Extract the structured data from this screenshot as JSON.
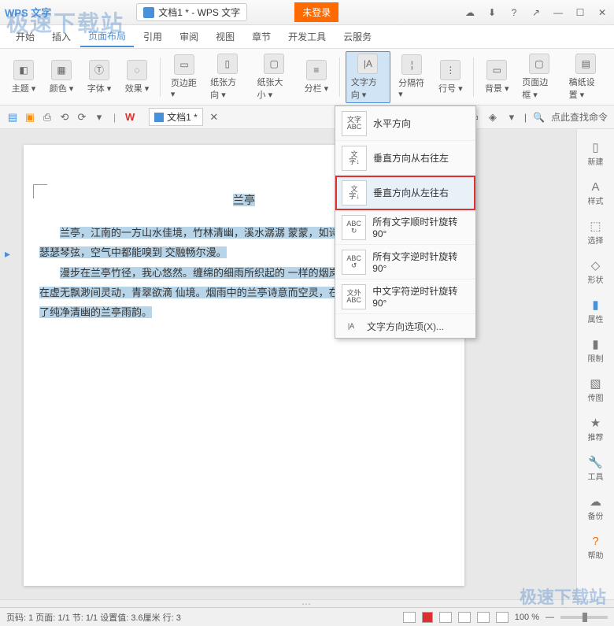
{
  "watermark": {
    "top": "极速下载站",
    "bottom": "极速下载站"
  },
  "titlebar": {
    "app": "WPS 文字",
    "doc": "文档1 * - WPS 文字",
    "login": "未登录",
    "icons": [
      "☁",
      "⬇",
      "?",
      "↗",
      "—",
      "☐",
      "✕"
    ]
  },
  "menu": {
    "items": [
      "开始",
      "插入",
      "页面布局",
      "引用",
      "审阅",
      "视图",
      "章节",
      "开发工具",
      "云服务"
    ],
    "active_index": 2
  },
  "ribbon": {
    "groups": [
      {
        "label": "主题",
        "icon": "◧"
      },
      {
        "label": "颜色",
        "icon": "▦"
      },
      {
        "label": "字体",
        "icon": "Ⓣ"
      },
      {
        "label": "效果",
        "icon": "◌"
      },
      {
        "label": "页边距",
        "icon": "▭"
      },
      {
        "label": "纸张方向",
        "icon": "▯"
      },
      {
        "label": "纸张大小",
        "icon": "▢"
      },
      {
        "label": "分栏",
        "icon": "≡"
      },
      {
        "label": "文字方向",
        "icon": "|A",
        "active": true
      },
      {
        "label": "分隔符",
        "icon": "¦"
      },
      {
        "label": "行号",
        "icon": "⋮"
      },
      {
        "label": "背景",
        "icon": "▭"
      },
      {
        "label": "页面边框",
        "icon": "▢"
      },
      {
        "label": "稿纸设置",
        "icon": "▤"
      }
    ]
  },
  "quick": {
    "left_icons": [
      "▤",
      "▣",
      "⎙",
      "⟲",
      "⟳",
      "▾"
    ],
    "w_icon": "W",
    "doc_tab": "文档1 *",
    "close": "✕",
    "right_icons": [
      "▭",
      "◈",
      "▾"
    ],
    "search_label": "点此查找命令"
  },
  "dropdown": {
    "items": [
      {
        "icon_top": "文字",
        "icon_bottom": "ABC",
        "label": "水平方向"
      },
      {
        "icon_top": "文",
        "icon_bottom": "字↓",
        "label": "垂直方向从右往左"
      },
      {
        "icon_top": "文",
        "icon_bottom": "字↓",
        "label": "垂直方向从左往右",
        "selected": true
      },
      {
        "icon_top": "ABC",
        "icon_bottom": "↻",
        "label": "所有文字顺时针旋转90°"
      },
      {
        "icon_top": "ABC",
        "icon_bottom": "↺",
        "label": "所有文字逆时针旋转90°"
      },
      {
        "icon_top": "文外",
        "icon_bottom": "ABC",
        "label": "中文字符逆时针旋转90°"
      }
    ],
    "more_icon": "|A",
    "more_label": "文字方向选项(X)..."
  },
  "document": {
    "title": "兰亭",
    "paragraphs": [
      "兰亭，江南的一方山水佳境，竹林清幽，溪水潺潺                        蒙蒙，如诗如画。风拂过竹林拂动瑟瑟琴弦，空气中都能嗅到                        交融畅尔漫。",
      "漫步在兰亭竹径，我心悠然。缠绵的细雨所织起的                        一样的烟岚，使山水、竹林、花草在虚无飘渺间灵动，青翠欲滴                        仙境。烟雨中的兰亭诗意而空灵，在细雨蒙蒙中我真正体味了纯净清幽的兰亭雨韵。"
    ]
  },
  "sidebar": [
    {
      "icon": "▯",
      "label": "新建"
    },
    {
      "icon": "A",
      "label": "样式"
    },
    {
      "icon": "⬚",
      "label": "选择"
    },
    {
      "icon": "◇",
      "label": "形状"
    },
    {
      "icon": "▮",
      "label": "属性",
      "blue": true
    },
    {
      "icon": "▮",
      "label": "限制"
    },
    {
      "icon": "▧",
      "label": "传图"
    },
    {
      "icon": "★",
      "label": "推荐"
    },
    {
      "icon": "🔧",
      "label": "工具",
      "orange": true
    },
    {
      "icon": "☁",
      "label": "备份"
    },
    {
      "icon": "?",
      "label": "帮助",
      "orange": true
    }
  ],
  "status": {
    "left": "页码: 1  页面: 1/1  节: 1/1  设置值: 3.6厘米  行: 3",
    "zoom": "100 %"
  }
}
